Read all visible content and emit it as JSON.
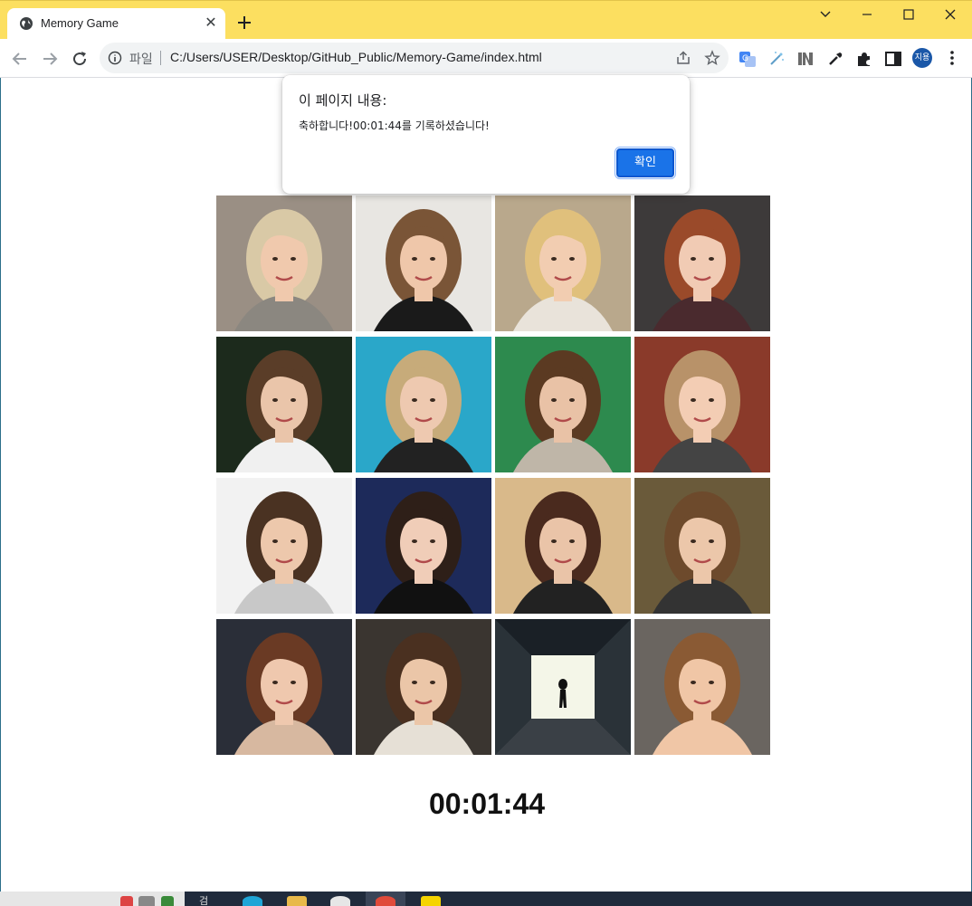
{
  "browser": {
    "tab_title": "Memory Game",
    "scheme_label": "파일",
    "url": "C:/Users/USER/Desktop/GitHub_Public/Memory-Game/index.html",
    "profile_label": "지용",
    "accent": "#fcdf60"
  },
  "dialog": {
    "title": "이 페이지 내용:",
    "message": "축하합니다!00:01:44를 기록하셨습니다!",
    "ok_label": "확인"
  },
  "game": {
    "timer": "00:01:44",
    "cards": [
      {
        "name": "card-blonde-updo",
        "bg": "#9a8f84",
        "hair": "#d9c9a6",
        "skin": "#f0c9ad",
        "top": "#8b8780"
      },
      {
        "name": "card-brunette-black-top",
        "bg": "#e8e6e2",
        "hair": "#7a5537",
        "skin": "#efc7aa",
        "top": "#1a1a1a"
      },
      {
        "name": "card-blonde-waves",
        "bg": "#b9a88c",
        "hair": "#e0c07c",
        "skin": "#f2cdb1",
        "top": "#e9e3da"
      },
      {
        "name": "card-red-hair",
        "bg": "#3d3a3a",
        "hair": "#9a4a2a",
        "skin": "#f1cbb4",
        "top": "#4a2a2e"
      },
      {
        "name": "card-brown-bob",
        "bg": "#1c2a1c",
        "hair": "#5a3d28",
        "skin": "#eac5aa",
        "top": "#f0f0f0"
      },
      {
        "name": "card-blonde-blue-bg",
        "bg": "#2aa7c9",
        "hair": "#c7ab7a",
        "skin": "#eec9b0",
        "top": "#222"
      },
      {
        "name": "card-long-brown-green-bg",
        "bg": "#2d8a4e",
        "hair": "#5b3a22",
        "skin": "#e9c2a6",
        "top": "#bfb6a8"
      },
      {
        "name": "card-blonde-bob",
        "bg": "#8a3a2a",
        "hair": "#b89269",
        "skin": "#f3cdb4",
        "top": "#444"
      },
      {
        "name": "card-short-brown-white-bg",
        "bg": "#f2f2f2",
        "hair": "#4a3222",
        "skin": "#edc8ac",
        "top": "#c8c8c8"
      },
      {
        "name": "card-dark-bangs-blue-bg",
        "bg": "#1d2a5a",
        "hair": "#2e1f18",
        "skin": "#f0cdb8",
        "top": "#111"
      },
      {
        "name": "card-brunette-festival",
        "bg": "#d9b98a",
        "hair": "#4a2a1e",
        "skin": "#eac4a8",
        "top": "#222"
      },
      {
        "name": "card-long-brown-hair",
        "bg": "#6a5a3a",
        "hair": "#6d4a2c",
        "skin": "#ecc7aa",
        "top": "#333"
      },
      {
        "name": "card-auburn-waves",
        "bg": "#2a2e38",
        "hair": "#6a3a24",
        "skin": "#efc8ae",
        "top": "#d7b8a0"
      },
      {
        "name": "card-brunette-smile",
        "bg": "#3a3530",
        "hair": "#4a3020",
        "skin": "#ebc6a8",
        "top": "#e6e0d6"
      },
      {
        "name": "card-alien-tunnel",
        "bg": "#0f1418",
        "hair": "",
        "skin": "",
        "top": "",
        "special": "alien"
      },
      {
        "name": "card-long-light-brown",
        "bg": "#6a6560",
        "hair": "#8a5a34",
        "skin": "#f0c6a6",
        "top": "#f0c6a6"
      }
    ]
  },
  "taskbar": {
    "search_label": "검"
  }
}
